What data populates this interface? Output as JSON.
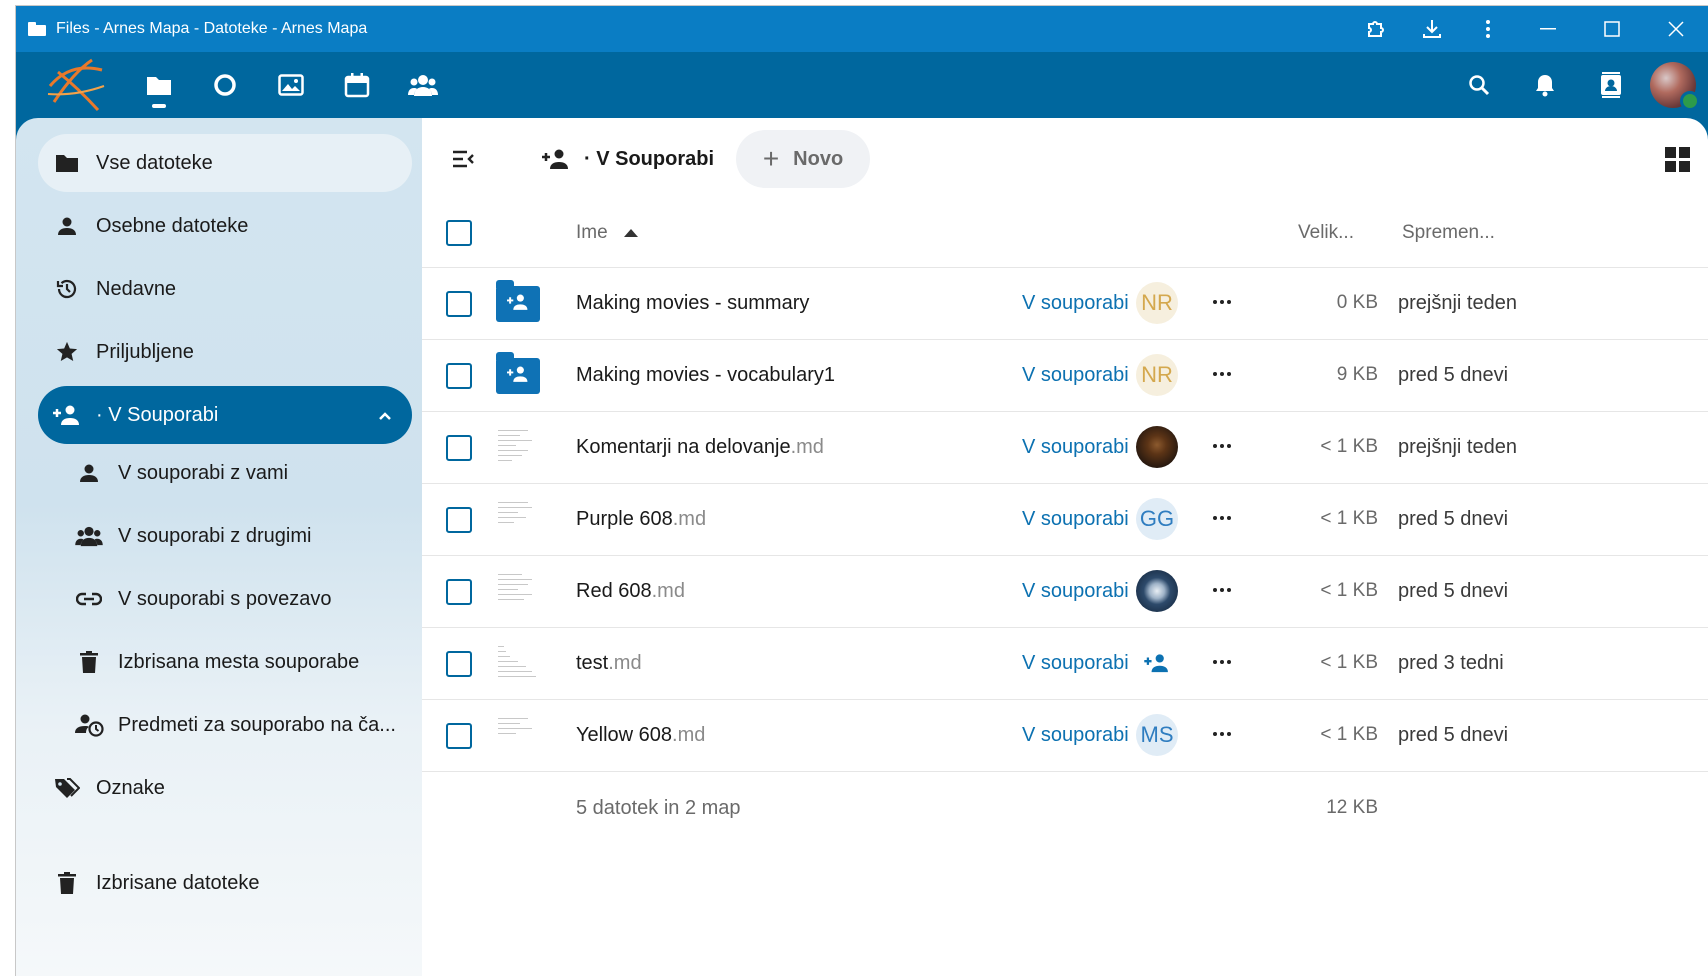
{
  "window": {
    "title": "Files - Arnes Mapa - Datoteke - Arnes Mapa",
    "icons": [
      "extensions-icon",
      "download-icon",
      "kebab-menu-icon",
      "minimize-icon",
      "maximize-icon",
      "close-icon"
    ]
  },
  "header": {
    "apps": [
      {
        "name": "Files",
        "icon": "folder-icon",
        "active": true
      },
      {
        "name": "Activity",
        "icon": "circle-icon"
      },
      {
        "name": "Photos",
        "icon": "image-icon"
      },
      {
        "name": "Calendar",
        "icon": "calendar-icon"
      },
      {
        "name": "Contacts",
        "icon": "group-icon"
      }
    ],
    "right_icons": [
      "search-icon",
      "bell-icon",
      "contacts-icon",
      "avatar"
    ]
  },
  "sidebar": {
    "items": [
      {
        "label": "Vse datoteke",
        "icon": "folder-icon"
      },
      {
        "label": "Osebne datoteke",
        "icon": "person-icon"
      },
      {
        "label": "Nedavne",
        "icon": "history-icon"
      },
      {
        "label": "Priljubljene",
        "icon": "star-icon"
      },
      {
        "label": "· V Souporabi",
        "icon": "share-icon"
      },
      {
        "label": "V souporabi z vami",
        "icon": "person-icon"
      },
      {
        "label": "V souporabi z drugimi",
        "icon": "group-icon"
      },
      {
        "label": "V souporabi s povezavo",
        "icon": "link-icon"
      },
      {
        "label": "Izbrisana mesta souporabe",
        "icon": "trash-icon"
      },
      {
        "label": "Predmeti za souporabo na ča...",
        "icon": "pending-icon"
      },
      {
        "label": "Oznake",
        "icon": "tag-icon"
      },
      {
        "label": "Izbrisane datoteke",
        "icon": "trash-icon"
      }
    ]
  },
  "main": {
    "breadcrumb": "· V Souporabi",
    "new_button": "Novo",
    "columns": {
      "name": "Ime",
      "size": "Velik...",
      "modified": "Spremen..."
    },
    "files": [
      {
        "name": "Making movies - summary",
        "ext": "",
        "type": "folder",
        "share": "V souporabi",
        "avatar": "NR",
        "size": "0 KB",
        "modified": "prejšnji teden"
      },
      {
        "name": "Making movies - vocabulary1",
        "ext": "",
        "type": "folder",
        "share": "V souporabi",
        "avatar": "NR",
        "size": "9 KB",
        "modified": "pred 5 dnevi"
      },
      {
        "name": "Komentarji na delovanje",
        "ext": ".md",
        "type": "doc",
        "share": "V souporabi",
        "avatar": "",
        "size": "< 1 KB",
        "modified": "prejšnji teden"
      },
      {
        "name": "Purple 608",
        "ext": ".md",
        "type": "doc",
        "share": "V souporabi",
        "avatar": "GG",
        "size": "< 1 KB",
        "modified": "pred 5 dnevi"
      },
      {
        "name": "Red 608",
        "ext": ".md",
        "type": "doc",
        "share": "V souporabi",
        "avatar": "",
        "size": "< 1 KB",
        "modified": "pred 5 dnevi"
      },
      {
        "name": "test",
        "ext": ".md",
        "type": "doc",
        "share": "V souporabi",
        "avatar": "",
        "size": "< 1 KB",
        "modified": "pred 3 tedni"
      },
      {
        "name": "Yellow 608",
        "ext": ".md",
        "type": "doc",
        "share": "V souporabi",
        "avatar": "MS",
        "size": "< 1 KB",
        "modified": "pred 5 dnevi"
      }
    ],
    "summary": {
      "text": "5 datotek in 2 map",
      "size": "12 KB"
    }
  },
  "colors": {
    "brand": "#00679e",
    "titlebar": "#0a7dc4",
    "link": "#0c71b1"
  }
}
